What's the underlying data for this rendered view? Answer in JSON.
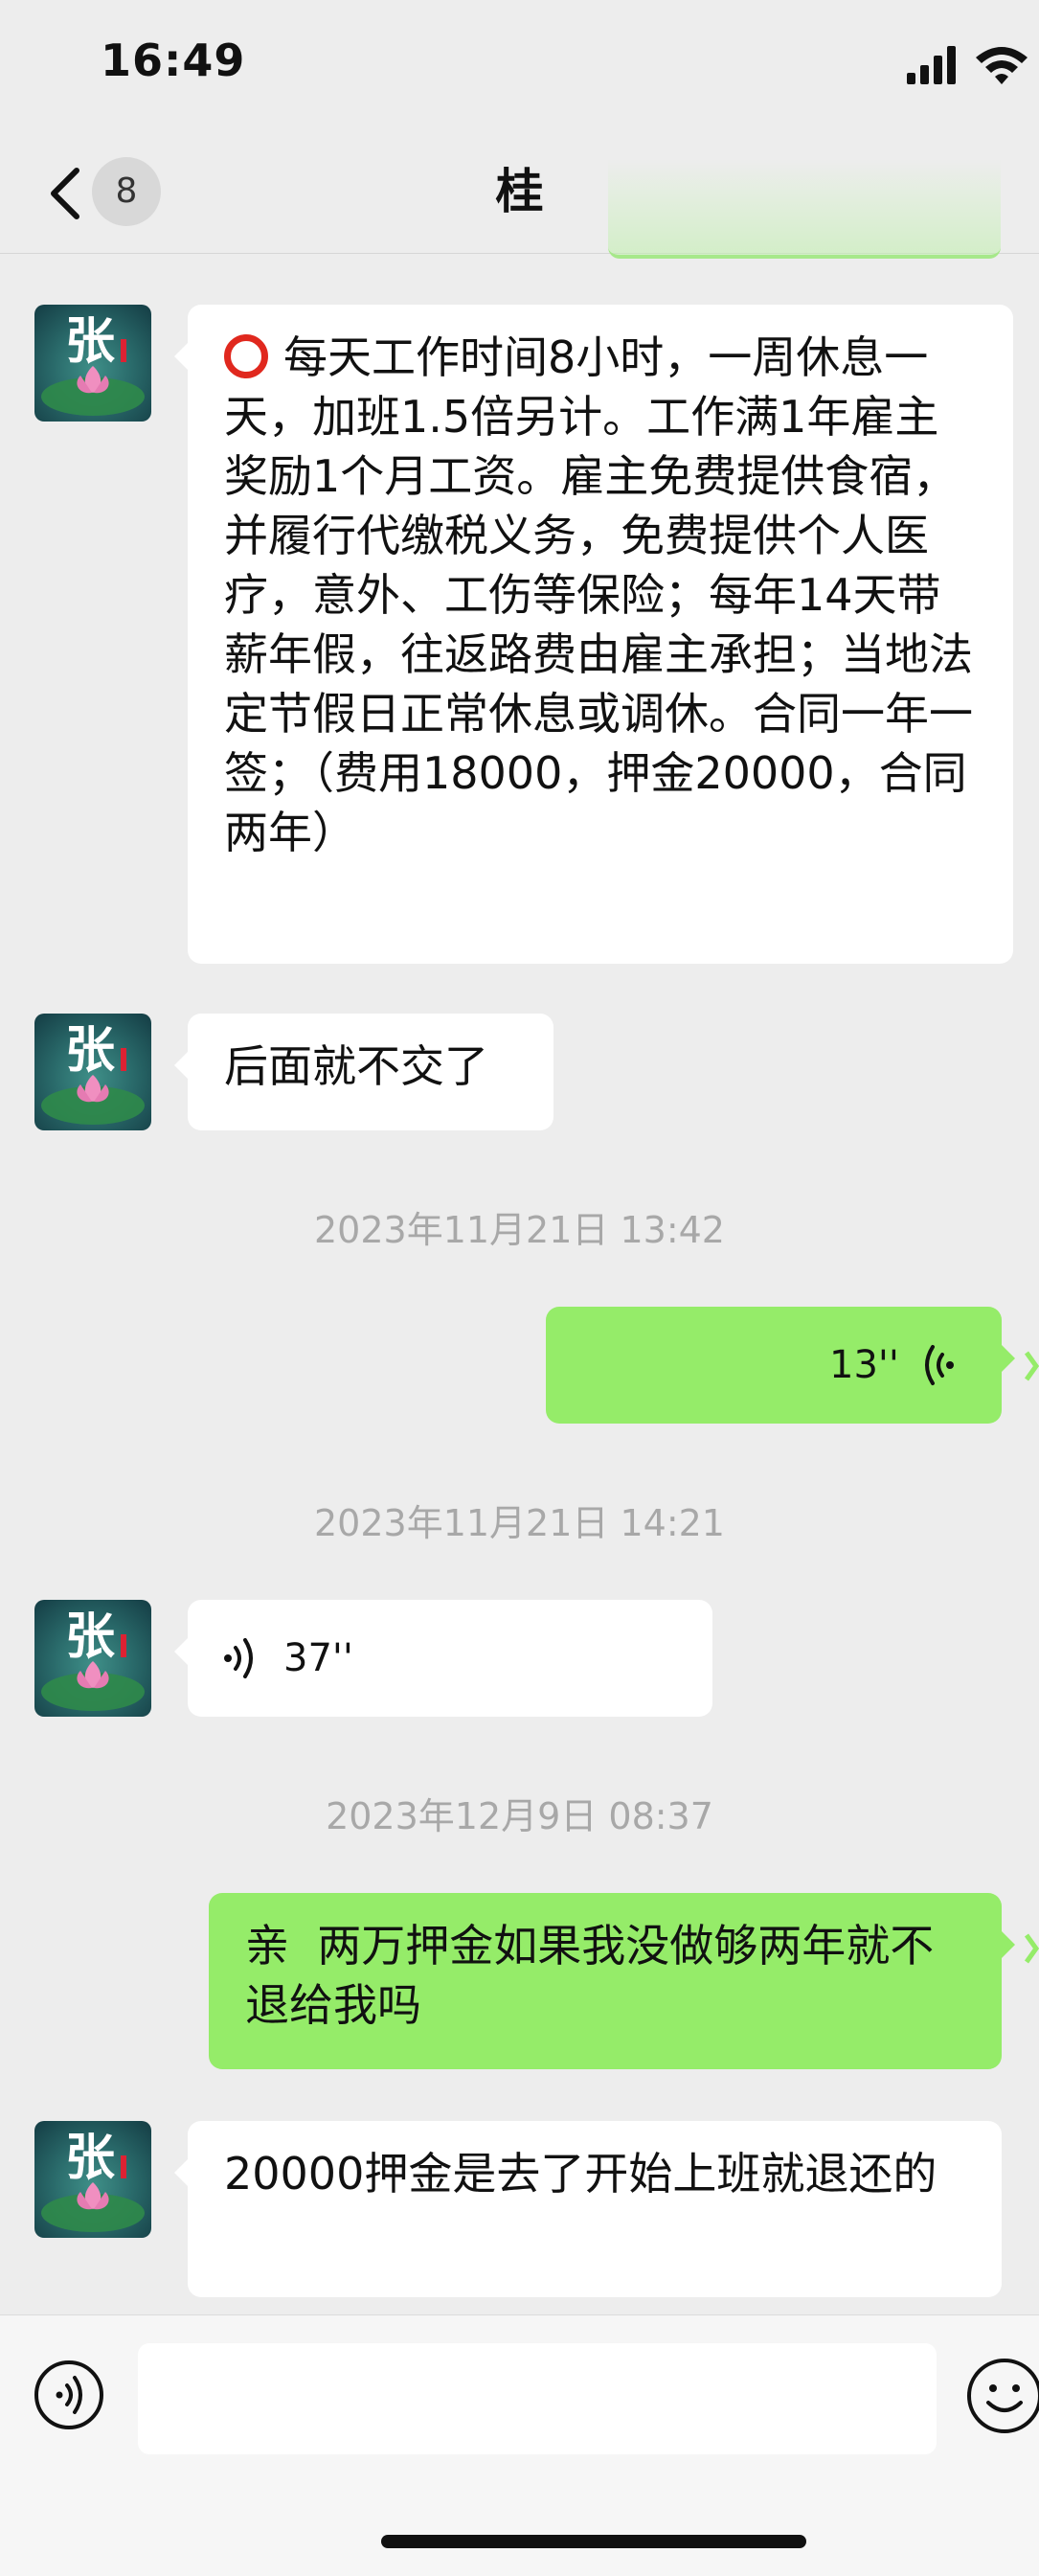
{
  "status_bar": {
    "time": "16:49"
  },
  "nav": {
    "back_label": "8",
    "title": "桂"
  },
  "messages": {
    "m1": {
      "text": "每天工作时间8小时，一周休息一天，加班1.5倍另计。工作满1年雇主奖励1个月工资。雇主免费提供食宿，并履行代缴税义务，免费提供个人医疗，意外、工伤等保险；每年14天带薪年假，往返路费由雇主承担；当地法定节假日正常休息或调休。合同一年一签；（费用18000，押金20000，合同两年）"
    },
    "m2": {
      "text": "后面就不交了"
    },
    "ts1": "2023年11月21日 13:42",
    "m3": {
      "duration": "13''"
    },
    "ts2": "2023年11月21日 14:21",
    "m4": {
      "duration": "37''"
    },
    "ts3": "2023年12月9日 08:37",
    "m5": {
      "text": "亲  两万押金如果我没做够两年就不退给我吗"
    },
    "m6": {
      "text": "20000押金是去了开始上班就退还的"
    }
  },
  "avatar": {
    "glyph": "张"
  },
  "icons": {
    "status": [
      "signal-icon",
      "wifi-icon"
    ],
    "nav": [
      "back-chevron-icon"
    ],
    "input": [
      "voice-mode-icon",
      "emoji-icon"
    ],
    "message": [
      "red-circle-icon",
      "voice-wave-icon"
    ]
  },
  "colors": {
    "bubble_me": "#95ec69",
    "bubble_other": "#ffffff",
    "background": "#ededed"
  }
}
